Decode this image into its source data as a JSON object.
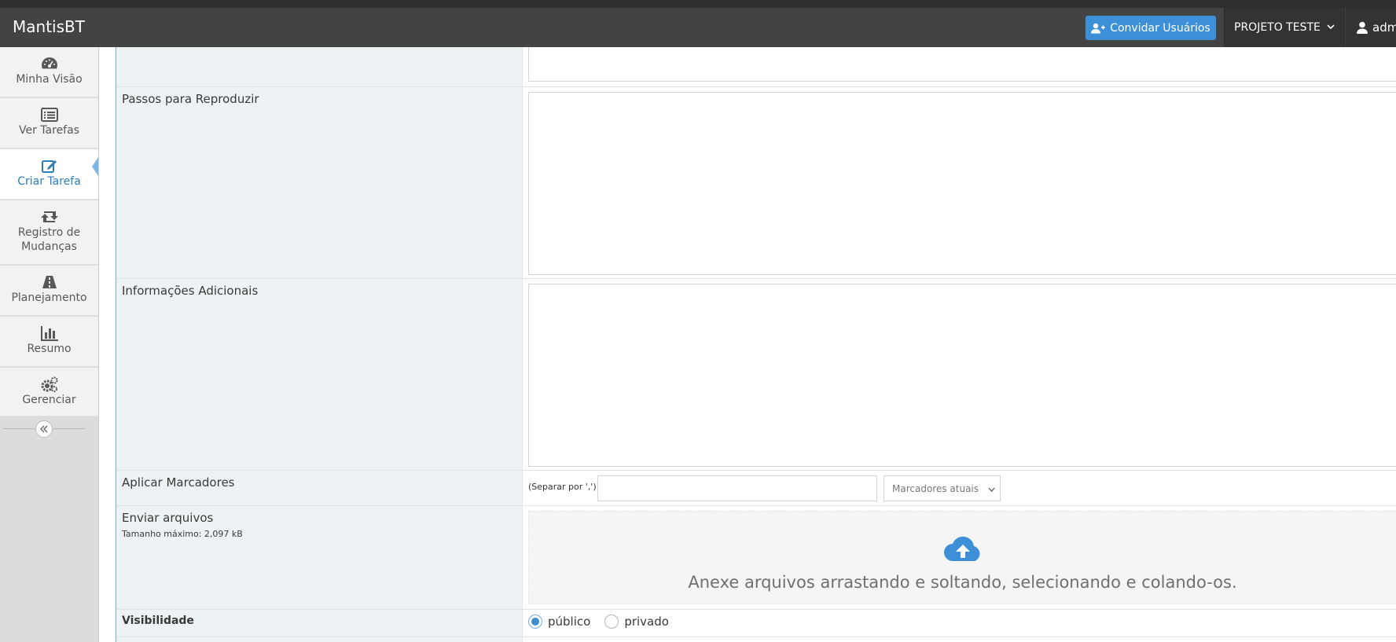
{
  "app": {
    "brand": "MantisBT",
    "invite_label": "Convidar Usuários",
    "project": "PROJETO TESTE",
    "user": "admin"
  },
  "sidebar": {
    "items": [
      {
        "label": "Minha Visão",
        "icon": "dashboard-icon"
      },
      {
        "label": "Ver Tarefas",
        "icon": "list-icon"
      },
      {
        "label": "Criar Tarefa",
        "icon": "edit-icon",
        "active": true
      },
      {
        "label": "Registro de Mudanças",
        "icon": "retweet-icon"
      },
      {
        "label": "Planejamento",
        "icon": "road-icon"
      },
      {
        "label": "Resumo",
        "icon": "bar-chart-icon"
      },
      {
        "label": "Gerenciar",
        "icon": "gears-icon"
      }
    ]
  },
  "form": {
    "steps_label": "Passos para Reproduzir",
    "additional_label": "Informações Adicionais",
    "tags_label": "Aplicar Marcadores",
    "tags_hint": "(Separar por ',')",
    "tags_select": "Marcadores atuais",
    "upload_label": "Enviar arquivos",
    "upload_max": "Tamanho máximo: 2,097 kB",
    "dropzone_text": "Anexe arquivos arrastando e soltando, selecionando e colando-os.",
    "visibility_label": "Visibilidade",
    "visibility_public": "público",
    "visibility_private": "privado",
    "visibility_selected": "público"
  },
  "colors": {
    "navbar": "#434343",
    "accent": "#3d8fd8",
    "category_bg": "#edf3f4",
    "sidebar_bg": "#f2f2f2"
  }
}
